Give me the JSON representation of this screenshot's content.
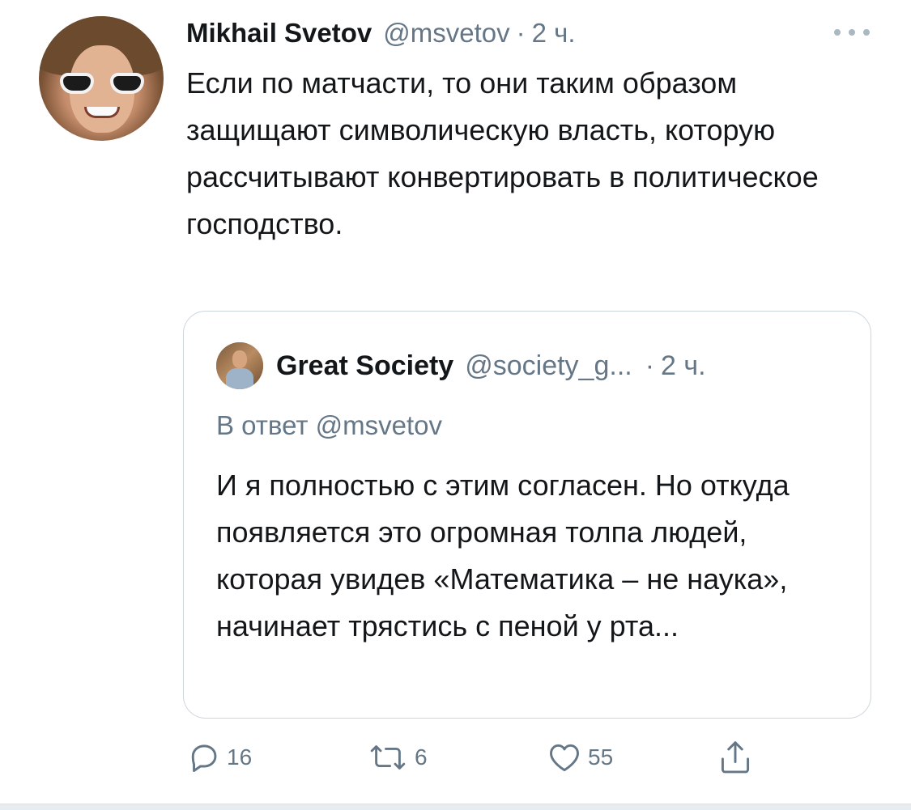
{
  "tweet": {
    "author_name": "Mikhail Svetov",
    "author_handle": "@msvetov",
    "separator": "·",
    "time": "2 ч.",
    "text": "Если по матчасти, то они таким образом защищают символическую власть, которую рассчитывают конвертировать в политическое господство."
  },
  "quote": {
    "author_name": "Great Society",
    "author_handle": "@society_g...",
    "separator": "·",
    "time": "2 ч.",
    "reply_to": "В ответ @msvetov",
    "text": "И я полностью с этим согласен. Но откуда появляется это огромная толпа людей, которая увидев «Математика – не наука», начинает трястись с пеной у рта..."
  },
  "actions": {
    "reply_count": "16",
    "retweet_count": "6",
    "like_count": "55"
  },
  "icons": {
    "more": "more-icon",
    "reply": "reply-icon",
    "retweet": "retweet-icon",
    "like": "heart-icon",
    "share": "share-icon"
  },
  "colors": {
    "text_primary": "#14171a",
    "text_secondary": "#657786",
    "border": "#ccd6dd"
  }
}
